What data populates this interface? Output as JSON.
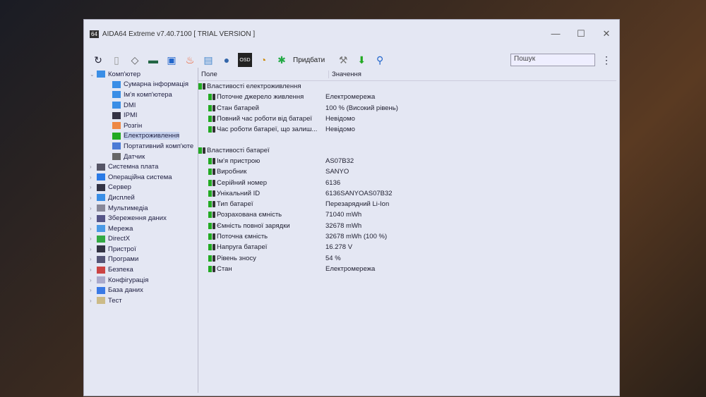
{
  "window": {
    "logo": "64",
    "title": "AIDA64 Extreme v7.40.7100  [ TRIAL VERSION ]",
    "minimize": "—",
    "maximize": "☐",
    "close": "✕"
  },
  "toolbar": {
    "icons": [
      "refresh",
      "report",
      "motherboard",
      "memory",
      "network",
      "flame",
      "sensor",
      "user",
      "osd",
      "gauge"
    ],
    "buy_label": "Придбати",
    "search_placeholder": "Пошук",
    "more": "⋮"
  },
  "tree": {
    "root": "Комп'ютер",
    "children": [
      "Сумарна інформація",
      "Ім'я комп'ютера",
      "DMI",
      "IPMI",
      "Розгін",
      "Електроживлення",
      "Портативний комп'юте",
      "Датчик"
    ],
    "items": [
      "Системна плата",
      "Операційна система",
      "Сервер",
      "Дисплей",
      "Мультимедіа",
      "Збереження даних",
      "Мережа",
      "DirectX",
      "Пристрої",
      "Програми",
      "Безпека",
      "Конфігурація",
      "База даних",
      "Тест"
    ]
  },
  "table": {
    "col_field": "Поле",
    "col_value": "Значення",
    "group1": "Властивості електроживлення",
    "rows1": [
      [
        "Поточне джерело живлення",
        "Електромережа"
      ],
      [
        "Стан батарей",
        "100 % (Високий рівень)"
      ],
      [
        "Повний час роботи від батареї",
        "Невідомо"
      ],
      [
        "Час роботи батареї, що залиш...",
        "Невідомо"
      ]
    ],
    "group2": "Властивості батареї",
    "rows2": [
      [
        "Ім'я пристрою",
        "AS07B32"
      ],
      [
        "Виробник",
        "SANYO"
      ],
      [
        "Серійний номер",
        "6136"
      ],
      [
        "Унікальний ID",
        "6136SANYOAS07B32"
      ],
      [
        "Тип батареї",
        "Перезарядний Li-Ion"
      ],
      [
        "Розрахована ємність",
        "71040 mWh"
      ],
      [
        "Ємність повної зарядки",
        "32678 mWh"
      ],
      [
        "Поточна ємність",
        "32678 mWh  (100 %)"
      ],
      [
        "Напруга батареї",
        "16.278 V"
      ],
      [
        "Рівень зносу",
        "54 %"
      ],
      [
        "Стан",
        "Електромережа"
      ]
    ]
  }
}
